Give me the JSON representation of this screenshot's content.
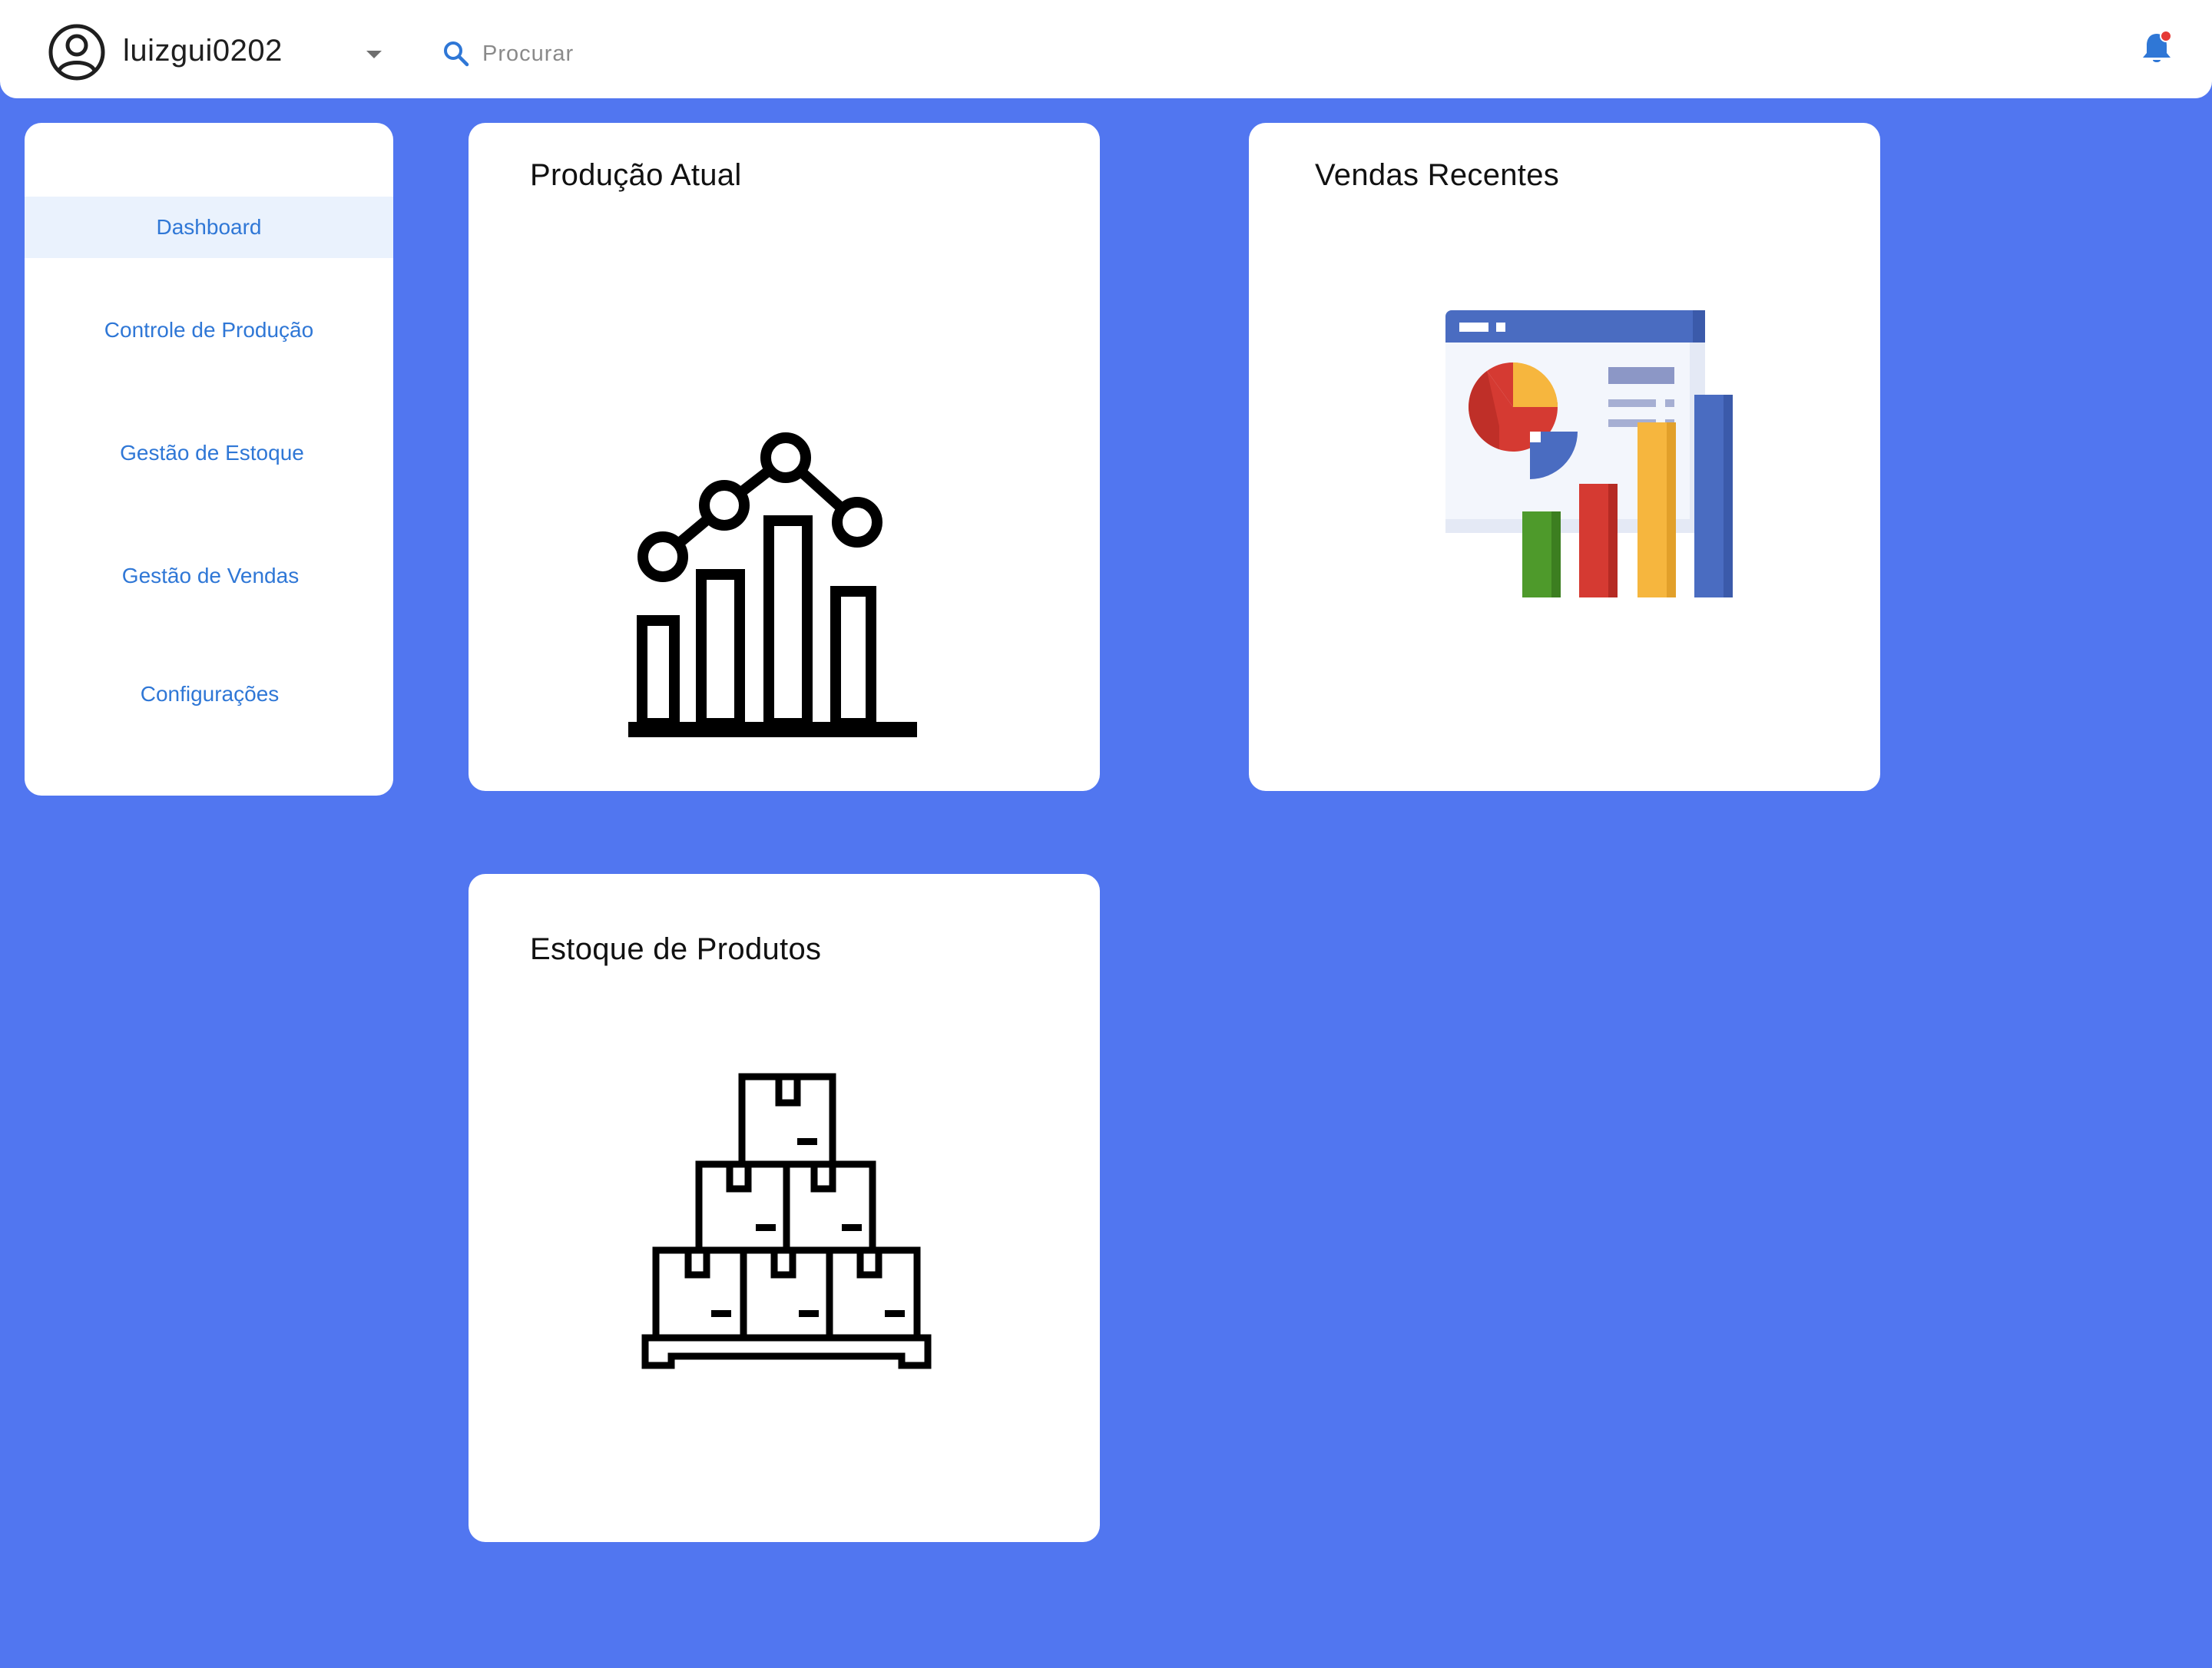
{
  "header": {
    "username": "luizgui0202",
    "search_placeholder": "Procurar",
    "has_notification": true,
    "icons": {
      "avatar": "account-circle-icon",
      "dropdown": "chevron-down-icon",
      "search": "search-icon",
      "bell": "bell-icon"
    },
    "accent": "#2F77D6",
    "notification_dot": "#E53935"
  },
  "sidebar": {
    "items": [
      {
        "label": "Dashboard",
        "active": true
      },
      {
        "label": "Controle de Produção",
        "active": false
      },
      {
        "label": "Gestão de Estoque",
        "active": false
      },
      {
        "label": "Gestão de Vendas",
        "active": false
      },
      {
        "label": "Configurações",
        "active": false
      }
    ]
  },
  "cards": [
    {
      "title": "Produção Atual",
      "illustration": "production-chart-icon"
    },
    {
      "title": "Vendas Recentes",
      "illustration": "sales-dashboard-illustration"
    },
    {
      "title": "Estoque de Produtos",
      "illustration": "stacked-boxes-pallet-icon"
    }
  ],
  "colors": {
    "background": "#5176F0",
    "surface": "#FFFFFF",
    "nav_text": "#2F77D6",
    "nav_active_bg": "#EAF2FD"
  }
}
